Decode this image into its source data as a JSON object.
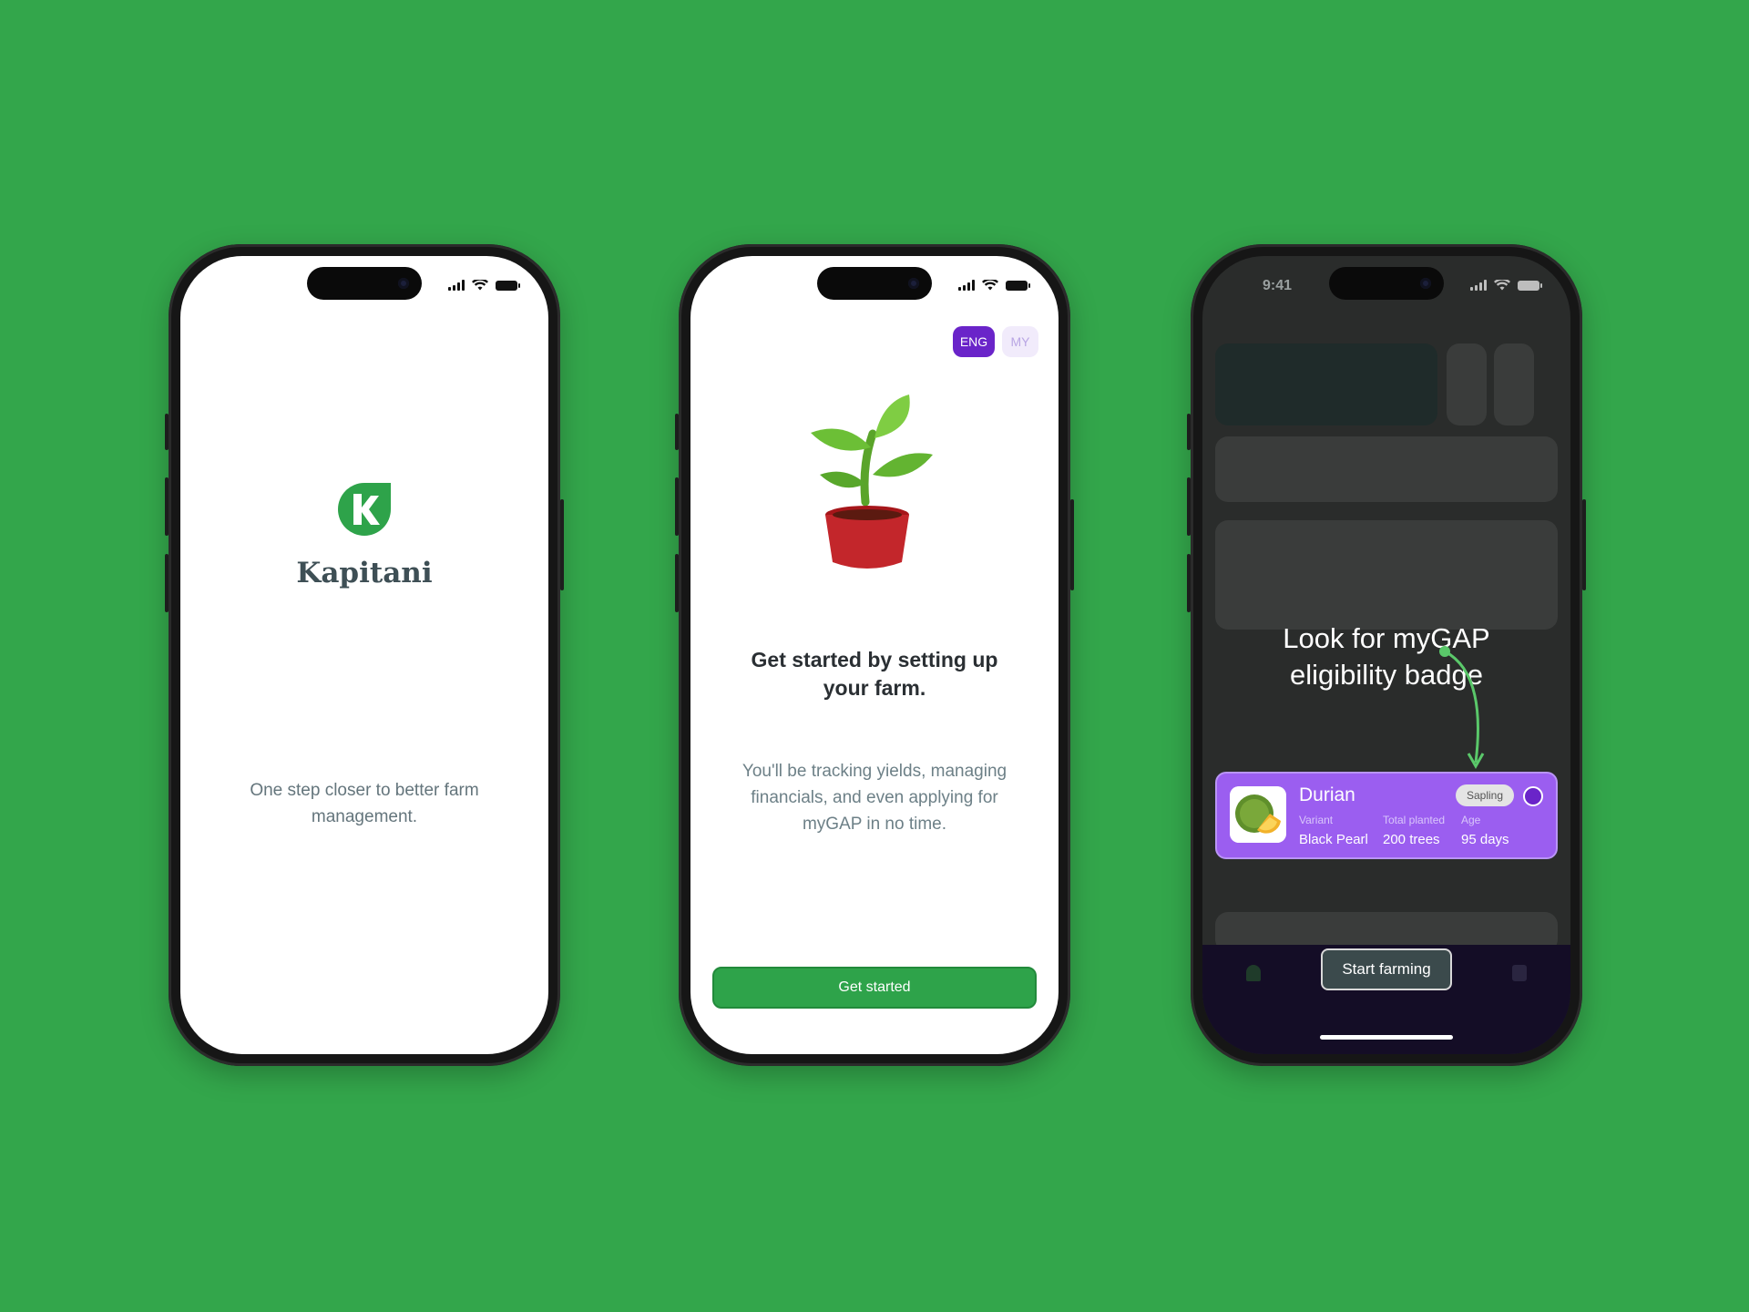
{
  "phones": {
    "splash": {
      "brand": "Kapitani",
      "tagline": "One step closer to better farm management."
    },
    "onboarding": {
      "languages": [
        "ENG",
        "MY"
      ],
      "selected_language": "ENG",
      "title": "Get started by setting up your farm.",
      "subtitle": "You'll be tracking yields, managing financials, and even applying for myGAP in no time.",
      "cta_label": "Get started"
    },
    "home": {
      "status_time": "9:41",
      "annotation": "Look for myGAP eligibility badge",
      "crop_card": {
        "name": "Durian",
        "stage": "Sapling",
        "variant_label": "Variant",
        "variant_value": "Black Pearl",
        "planted_label": "Total planted",
        "planted_value": "200 trees",
        "age_label": "Age",
        "age_value": "95 days"
      },
      "start_button": "Start farming"
    }
  },
  "colors": {
    "background": "#33a64b",
    "primary_green": "#2ea34a",
    "purple": "#6a24c9",
    "card_purple": "#9b5ef0"
  },
  "icons": [
    "signal-icon",
    "wifi-icon",
    "battery-icon",
    "kapitani-logo",
    "plant-pot-illustration",
    "durian-icon",
    "mygap-badge-icon"
  ]
}
